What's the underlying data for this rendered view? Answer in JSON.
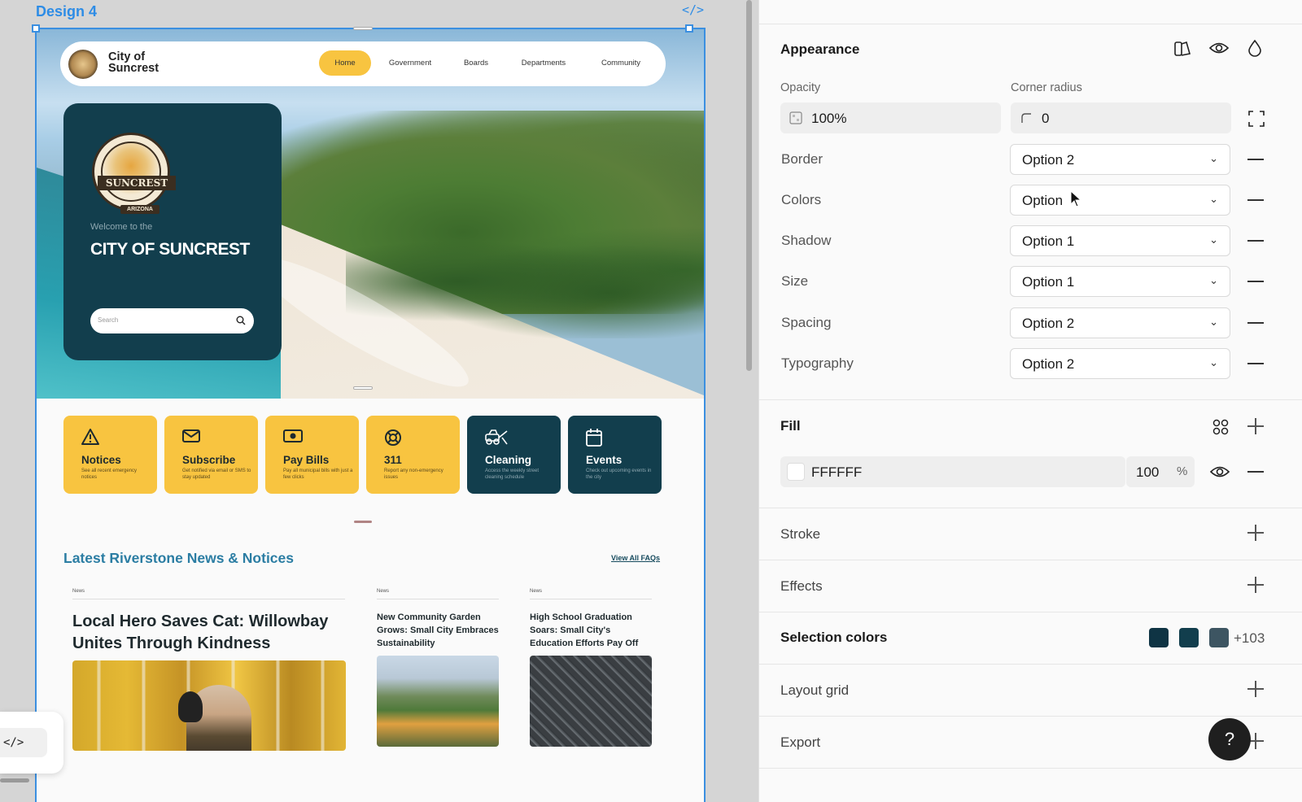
{
  "canvas": {
    "frame_title": "Design 4",
    "code_icon": "</>",
    "site": {
      "logo_text": "City of Suncrest",
      "nav": [
        "Home",
        "Government",
        "Boards",
        "Departments",
        "Community"
      ],
      "welcome_sub": "Welcome to the",
      "welcome_title": "CITY OF SUNCREST",
      "seal_band": "SUNCREST",
      "seal_bottom": "ARIZONA",
      "search_placeholder": "Search",
      "tiles": [
        {
          "label": "Notices",
          "desc": "See all recent emergency notices",
          "icon": "warning-icon",
          "style": "yellow"
        },
        {
          "label": "Subscribe",
          "desc": "Get notified via email or SMS to stay updated",
          "icon": "envelope-icon",
          "style": "yellow"
        },
        {
          "label": "Pay Bills",
          "desc": "Pay all municipal bills with just a few clicks",
          "icon": "cash-icon",
          "style": "yellow"
        },
        {
          "label": "311",
          "desc": "Report any non-emergency issues",
          "icon": "lifebuoy-icon",
          "style": "yellow"
        },
        {
          "label": "Cleaning",
          "desc": "Access the weekly street cleaning schedule",
          "icon": "sweeper-icon",
          "style": "dark"
        },
        {
          "label": "Events",
          "desc": "Check out upcoming events in the city",
          "icon": "calendar-icon",
          "style": "dark"
        }
      ],
      "news_heading": "Latest Riverstone News & Notices",
      "news_link": "View All FAQs",
      "news": [
        {
          "tag": "News",
          "title": "Local Hero Saves Cat: Willowbay Unites Through Kindness"
        },
        {
          "tag": "News",
          "title": "New Community Garden Grows: Small City Embraces Sustainability"
        },
        {
          "tag": "News",
          "title": "High School Graduation Soars: Small City's Education Efforts Pay Off"
        }
      ]
    },
    "float_code_label": "</>"
  },
  "panel": {
    "appearance": {
      "title": "Appearance",
      "opacity_label": "Opacity",
      "opacity_value": "100%",
      "radius_label": "Corner radius",
      "radius_value": "0",
      "rows": [
        {
          "label": "Border",
          "value": "Option 2"
        },
        {
          "label": "Colors",
          "value": "Option"
        },
        {
          "label": "Shadow",
          "value": "Option 1"
        },
        {
          "label": "Size",
          "value": "Option 1"
        },
        {
          "label": "Spacing",
          "value": "Option 2"
        },
        {
          "label": "Typography",
          "value": "Option 2"
        }
      ]
    },
    "fill": {
      "title": "Fill",
      "hex": "FFFFFF",
      "opacity": "100",
      "unit": "%"
    },
    "stroke": {
      "title": "Stroke"
    },
    "effects": {
      "title": "Effects"
    },
    "selection_colors": {
      "title": "Selection colors",
      "more": "+103",
      "colors": [
        "#0f3444",
        "#123e4d",
        "#3d5562"
      ]
    },
    "layout_grid": {
      "title": "Layout grid"
    },
    "export": {
      "title": "Export"
    },
    "help_label": "?"
  },
  "colors": {
    "accent": "#2d8ce6",
    "brand_dark": "#123e4d",
    "brand_yellow": "#f8c440",
    "news_heading": "#2b7da3"
  }
}
